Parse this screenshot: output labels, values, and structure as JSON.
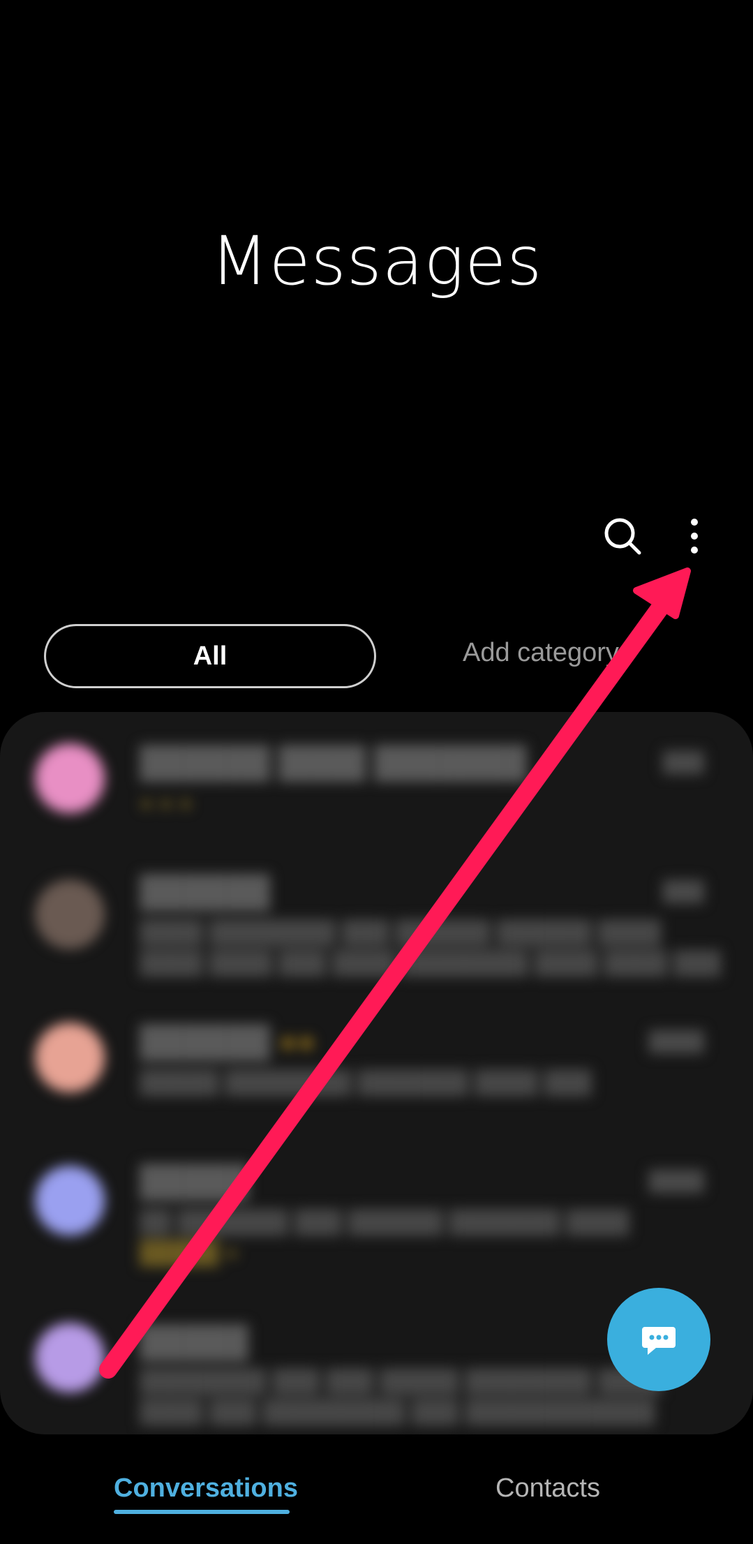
{
  "header": {
    "title": "Messages"
  },
  "toolbar": {
    "search_icon": "search-icon",
    "more_icon": "more-options-icon"
  },
  "tabs": {
    "all_label": "All",
    "add_category_label": "Add category"
  },
  "fab": {
    "icon": "new-message-icon"
  },
  "bottom_nav": {
    "conversations_label": "Conversations",
    "contacts_label": "Contacts"
  },
  "colors": {
    "accent": "#3aafde",
    "annotation_arrow": "#ff1a56",
    "background": "#000000"
  }
}
